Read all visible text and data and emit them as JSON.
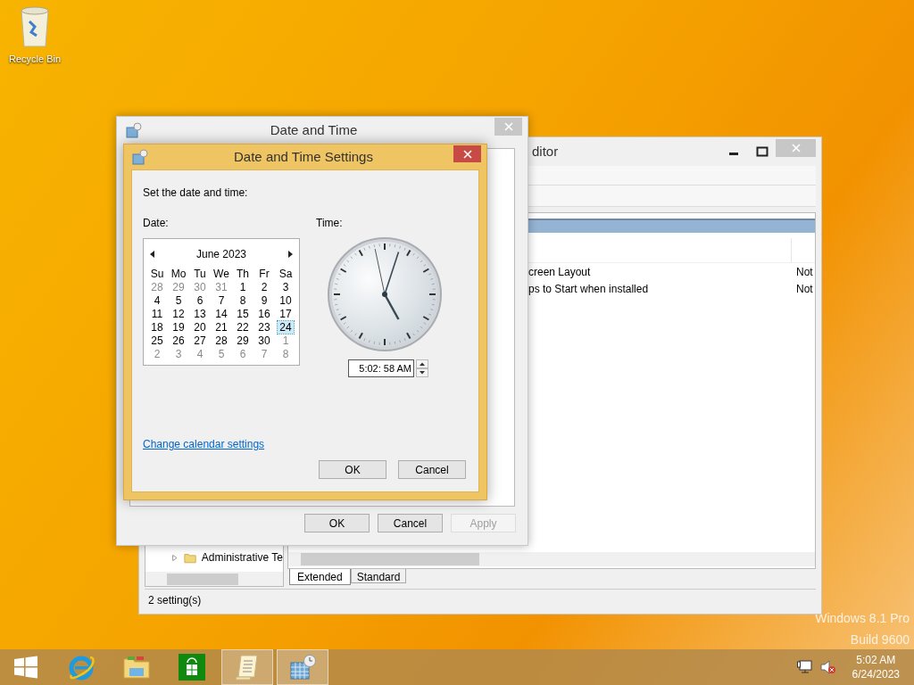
{
  "desktop": {
    "icons": [
      {
        "label": "Recycle Bin"
      }
    ],
    "watermark": [
      "Windows 8.1 Pro",
      "Build 9600"
    ]
  },
  "editor_window": {
    "title": "ditor",
    "rows": [
      {
        "column_1": "creen Layout",
        "column_2": "Not"
      },
      {
        "column_1": "ps to Start when installed",
        "column_2": "Not"
      }
    ],
    "tree_items": [
      {
        "label": "Administrative Te",
        "expanded": false
      }
    ],
    "tabs": [
      {
        "label": "Extended",
        "selected": true
      },
      {
        "label": "Standard",
        "selected": false
      }
    ],
    "status_bar": "2 setting(s)"
  },
  "date_time_window": {
    "title": "Date and Time",
    "buttons": [
      {
        "label": "OK",
        "disabled": false
      },
      {
        "label": "Cancel",
        "disabled": false
      },
      {
        "label": "Apply",
        "disabled": true
      }
    ]
  },
  "settings_dialog": {
    "title": "Date and Time Settings",
    "prompt": "Set the date and time:",
    "date_label": "Date:",
    "time_label": "Time:",
    "calendar": {
      "month": "June 2023",
      "weekdays": [
        "Su",
        "Mo",
        "Tu",
        "We",
        "Th",
        "Fr",
        "Sa"
      ],
      "weeks": [
        [
          {
            "day": "28",
            "dim": true,
            "selected": false
          },
          {
            "day": "29",
            "dim": true,
            "selected": false
          },
          {
            "day": "30",
            "dim": true,
            "selected": false
          },
          {
            "day": "31",
            "dim": true,
            "selected": false
          },
          {
            "day": "1",
            "dim": false,
            "selected": false
          },
          {
            "day": "2",
            "dim": false,
            "selected": false
          },
          {
            "day": "3",
            "dim": false,
            "selected": false
          }
        ],
        [
          {
            "day": "4",
            "dim": false,
            "selected": false
          },
          {
            "day": "5",
            "dim": false,
            "selected": false
          },
          {
            "day": "6",
            "dim": false,
            "selected": false
          },
          {
            "day": "7",
            "dim": false,
            "selected": false
          },
          {
            "day": "8",
            "dim": false,
            "selected": false
          },
          {
            "day": "9",
            "dim": false,
            "selected": false
          },
          {
            "day": "10",
            "dim": false,
            "selected": false
          }
        ],
        [
          {
            "day": "11",
            "dim": false,
            "selected": false
          },
          {
            "day": "12",
            "dim": false,
            "selected": false
          },
          {
            "day": "13",
            "dim": false,
            "selected": false
          },
          {
            "day": "14",
            "dim": false,
            "selected": false
          },
          {
            "day": "15",
            "dim": false,
            "selected": false
          },
          {
            "day": "16",
            "dim": false,
            "selected": false
          },
          {
            "day": "17",
            "dim": false,
            "selected": false
          }
        ],
        [
          {
            "day": "18",
            "dim": false,
            "selected": false
          },
          {
            "day": "19",
            "dim": false,
            "selected": false
          },
          {
            "day": "20",
            "dim": false,
            "selected": false
          },
          {
            "day": "21",
            "dim": false,
            "selected": false
          },
          {
            "day": "22",
            "dim": false,
            "selected": false
          },
          {
            "day": "23",
            "dim": false,
            "selected": false
          },
          {
            "day": "24",
            "dim": false,
            "selected": true
          }
        ],
        [
          {
            "day": "25",
            "dim": false,
            "selected": false
          },
          {
            "day": "26",
            "dim": false,
            "selected": false
          },
          {
            "day": "27",
            "dim": false,
            "selected": false
          },
          {
            "day": "28",
            "dim": false,
            "selected": false
          },
          {
            "day": "29",
            "dim": false,
            "selected": false
          },
          {
            "day": "30",
            "dim": false,
            "selected": false
          },
          {
            "day": "1",
            "dim": true,
            "selected": false
          }
        ],
        [
          {
            "day": "2",
            "dim": true,
            "selected": false
          },
          {
            "day": "3",
            "dim": true,
            "selected": false
          },
          {
            "day": "4",
            "dim": true,
            "selected": false
          },
          {
            "day": "5",
            "dim": true,
            "selected": false
          },
          {
            "day": "6",
            "dim": true,
            "selected": false
          },
          {
            "day": "7",
            "dim": true,
            "selected": false
          },
          {
            "day": "8",
            "dim": true,
            "selected": false
          }
        ]
      ]
    },
    "time_value": "5:02: 58 AM",
    "link": "Change calendar settings",
    "buttons": [
      "OK",
      "Cancel"
    ]
  },
  "taskbar": {
    "apps": [
      {
        "kind": "start",
        "active": false
      },
      {
        "kind": "browser",
        "active": false
      },
      {
        "kind": "explorer",
        "active": false
      },
      {
        "kind": "store",
        "active": false
      },
      {
        "kind": "scroll",
        "active": true
      },
      {
        "kind": "datetime",
        "active": true
      }
    ],
    "tray_time": "5:02 AM",
    "tray_date": "6/24/2023"
  }
}
